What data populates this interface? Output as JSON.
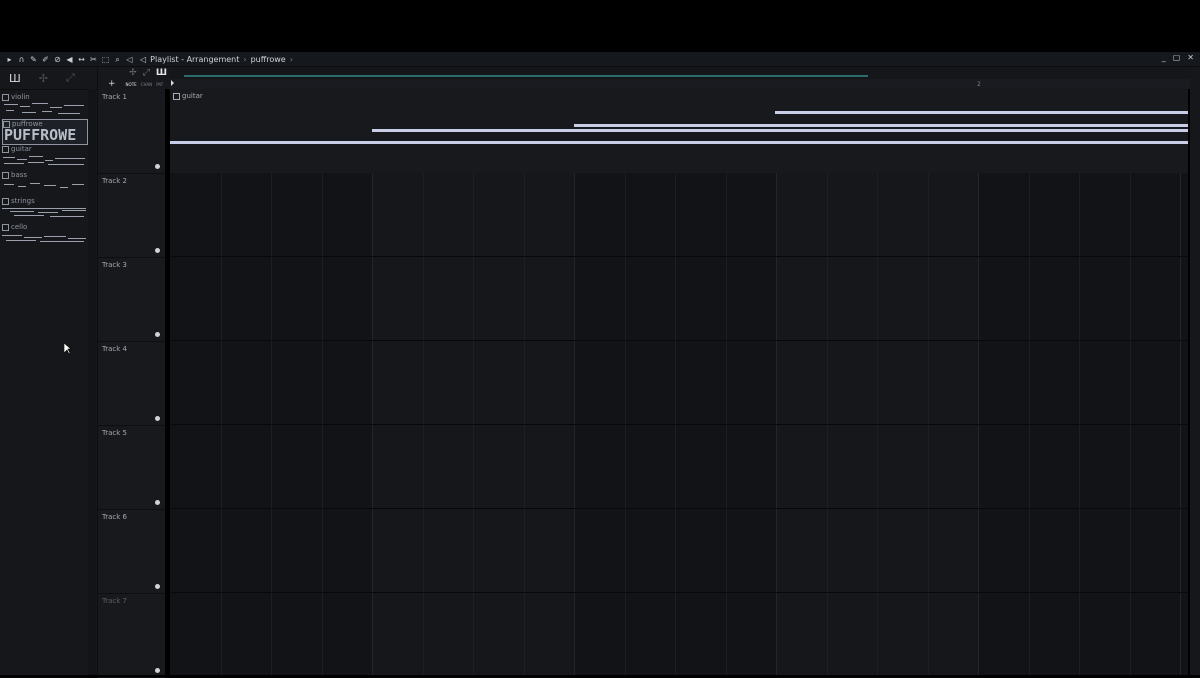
{
  "window": {
    "breadcrumb": [
      "Playlist - Arrangement",
      "puffrowe"
    ],
    "controls": [
      "_",
      "▢",
      "✕"
    ]
  },
  "toolbar_icons": [
    "play-arrow-icon",
    "magnet-icon",
    "pencil-icon",
    "paint-icon",
    "delete-icon",
    "mute-icon",
    "slip-icon",
    "slice-icon",
    "select-icon",
    "zoom-icon",
    "speaker-icon"
  ],
  "browser": {
    "tools": [
      "Ш",
      "✢",
      "⤢"
    ],
    "patterns": [
      {
        "name": "violin"
      },
      {
        "name": "puffrowe",
        "big_label": "PUFFROWE",
        "selected": true
      },
      {
        "name": "guitar"
      },
      {
        "name": "bass"
      },
      {
        "name": "strings"
      },
      {
        "name": "cello"
      }
    ]
  },
  "playlist_tools": {
    "icons": [
      "✢",
      "⤢",
      "Ш"
    ],
    "modes": [
      "NOTE",
      "CHAN",
      "PAT"
    ],
    "plus": "+"
  },
  "timeline": {
    "bar_marker": "2"
  },
  "tracks": [
    {
      "name": "Track 1"
    },
    {
      "name": "Track 2"
    },
    {
      "name": "Track 3"
    },
    {
      "name": "Track 4"
    },
    {
      "name": "Track 5"
    },
    {
      "name": "Track 6"
    },
    {
      "name": "Track 7"
    }
  ],
  "clip": {
    "track": 1,
    "label": "guitar"
  },
  "colors": {
    "note": "#c8cde8",
    "accent": "#2b6d6a",
    "background": "#121317"
  }
}
